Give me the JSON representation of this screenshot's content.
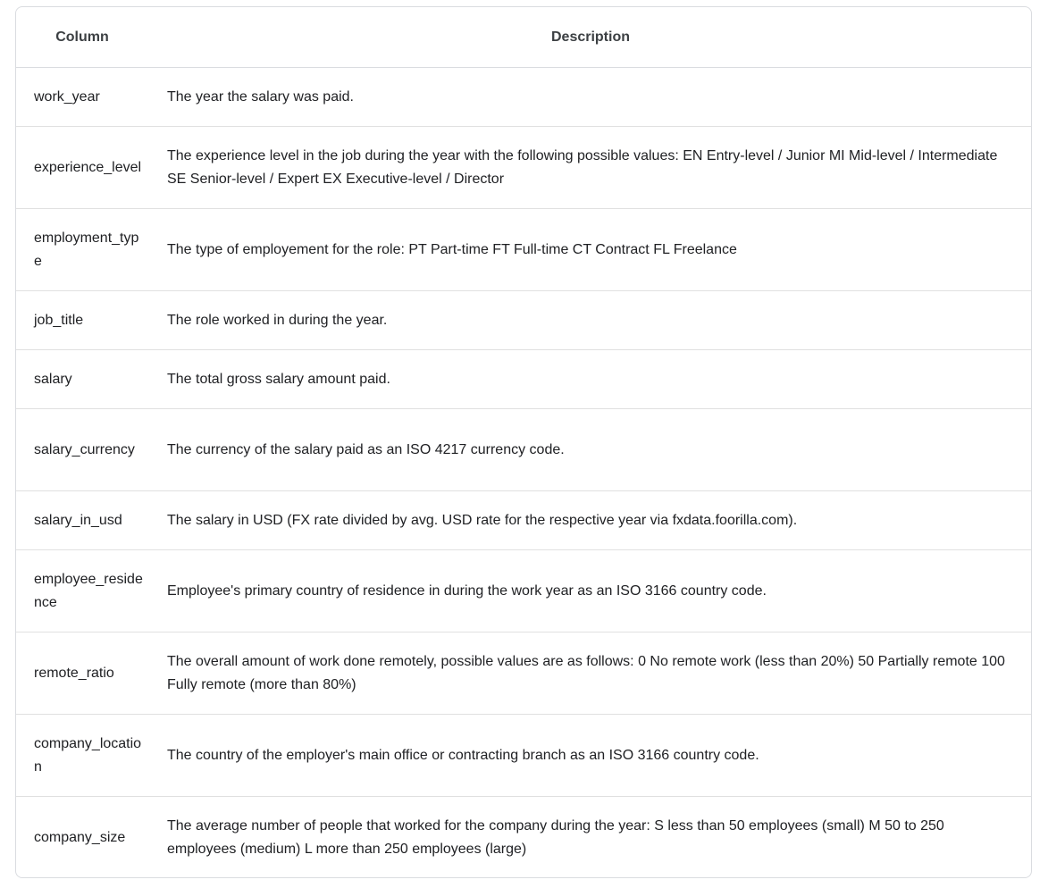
{
  "table": {
    "headers": {
      "column": "Column",
      "description": "Description"
    },
    "rows": [
      {
        "name": "work_year",
        "description": "The year the salary was paid."
      },
      {
        "name": "experience_level",
        "description": "The experience level in the job during the year with the following possible values: EN Entry-level / Junior MI Mid-level / Intermediate SE Senior-level / Expert EX Executive-level / Director"
      },
      {
        "name": "employment_type",
        "description": "The type of employement for the role: PT Part-time FT Full-time CT Contract FL Freelance"
      },
      {
        "name": "job_title",
        "description": "The role worked in during the year."
      },
      {
        "name": "salary",
        "description": "The total gross salary amount paid."
      },
      {
        "name": "salary_currency",
        "description": "The currency of the salary paid as an ISO 4217 currency code."
      },
      {
        "name": "salary_in_usd",
        "description": "The salary in USD (FX rate divided by avg. USD rate for the respective year via fxdata.foorilla.com)."
      },
      {
        "name": "employee_residence",
        "description": "Employee's primary country of residence in during the work year as an ISO 3166 country code."
      },
      {
        "name": "remote_ratio",
        "description": "The overall amount of work done remotely, possible values are as follows: 0 No remote work (less than 20%) 50 Partially remote 100 Fully remote (more than 80%)"
      },
      {
        "name": "company_location",
        "description": "The country of the employer's main office or contracting branch as an ISO 3166 country code."
      },
      {
        "name": "company_size",
        "description": "The average number of people that worked for the company during the year: S less than 50 employees (small) M 50 to 250 employees (medium) L more than 250 employees (large)"
      }
    ]
  }
}
